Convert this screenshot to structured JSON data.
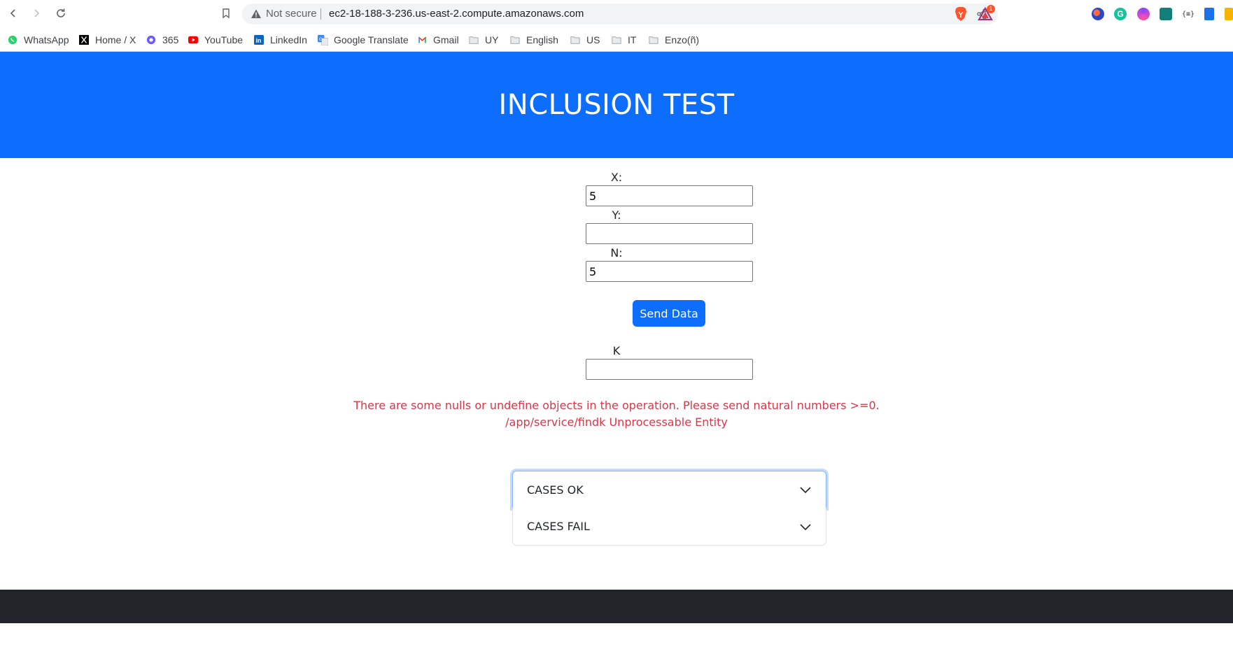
{
  "browser": {
    "security_label": "Not secure",
    "url": "ec2-18-188-3-236.us-east-2.compute.amazonaws.com",
    "rewards_badge": "1"
  },
  "bookmarks": [
    {
      "label": "WhatsApp",
      "icon": "whatsapp-icon"
    },
    {
      "label": "Home / X",
      "icon": "x-icon"
    },
    {
      "label": "365",
      "icon": "copilot-icon"
    },
    {
      "label": "YouTube",
      "icon": "youtube-icon"
    },
    {
      "label": "LinkedIn",
      "icon": "linkedin-icon"
    },
    {
      "label": "Google Translate",
      "icon": "translate-icon"
    },
    {
      "label": "Gmail",
      "icon": "gmail-icon"
    },
    {
      "label": "UY",
      "icon": "folder-icon"
    },
    {
      "label": "English",
      "icon": "folder-icon"
    },
    {
      "label": "US",
      "icon": "folder-icon"
    },
    {
      "label": "IT",
      "icon": "folder-icon"
    },
    {
      "label": "Enzo(ñ)",
      "icon": "folder-icon"
    }
  ],
  "page": {
    "title": "INCLUSION TEST",
    "x_label": "X:",
    "x_value": "5",
    "y_label": "Y:",
    "y_value": "",
    "n_label": "N:",
    "n_value": "5",
    "send_label": "Send Data",
    "k_label": "K",
    "k_value": "",
    "error_line1": "There are some nulls or undefine objects in the operation. Please send natural numbers >=0.",
    "error_line2": "/app/service/findk Unprocessable Entity",
    "accordion": [
      {
        "label": "CASES OK"
      },
      {
        "label": "CASES FAIL"
      }
    ]
  },
  "colors": {
    "primary": "#0d6efd",
    "danger": "#dc3545",
    "footer": "#212529"
  }
}
